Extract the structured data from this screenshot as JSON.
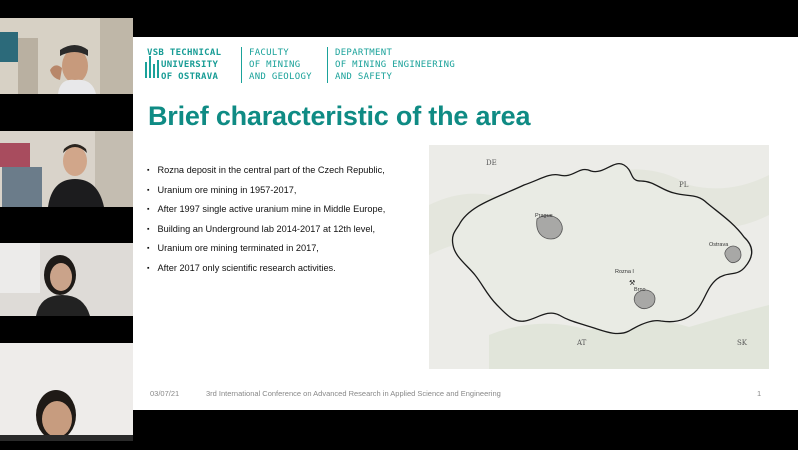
{
  "participants": [
    {
      "name": "participant-1"
    },
    {
      "name": "participant-2"
    },
    {
      "name": "participant-3"
    },
    {
      "name": "participant-4"
    }
  ],
  "slide": {
    "header": {
      "university": [
        "VSB TECHNICAL",
        "UNIVERSITY",
        "OF OSTRAVA"
      ],
      "faculty": [
        "FACULTY",
        "OF MINING",
        "AND GEOLOGY"
      ],
      "department": [
        "DEPARTMENT",
        "OF MINING ENGINEERING",
        "AND SAFETY"
      ]
    },
    "title": "Brief characteristic of the area",
    "bullets": [
      "Rozna deposit in the central part of the Czech Republic,",
      "Uranium ore mining in 1957-2017,",
      "After 1997 single active uranium mine in Middle Europe,",
      "Building an Underground lab 2014-2017 at 12th level,",
      "Uranium ore mining terminated in 2017,",
      "After 2017 only scientific research activities."
    ],
    "map": {
      "countries": {
        "de": "DE",
        "pl": "PL",
        "at": "AT",
        "sk": "SK"
      },
      "cities": {
        "prague": "Prague",
        "rozna": "Rozna I",
        "brno": "Brno",
        "ostrava": "Ostrava"
      }
    },
    "footer": {
      "date": "03/07/21",
      "conference": "3rd International Conference on Advanced Research in Applied Science and Engineering",
      "page": "1"
    }
  },
  "colors": {
    "accent": "#1aa29a",
    "title": "#0f8b84"
  }
}
